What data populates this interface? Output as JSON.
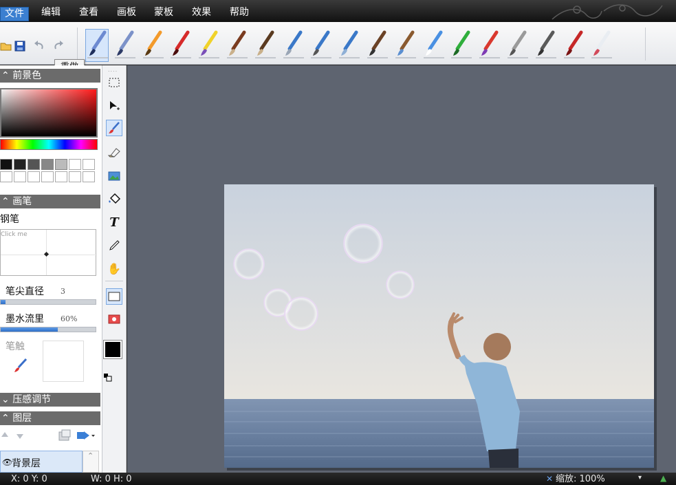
{
  "menu": {
    "items": [
      "文件",
      "编辑",
      "查看",
      "画板",
      "蒙板",
      "效果",
      "帮助"
    ],
    "active": 0
  },
  "toolbar": {
    "brushes": [
      {
        "icon": "pen-nib-icon"
      },
      {
        "icon": "calligraphy-pen-icon"
      },
      {
        "icon": "pencil-icon"
      },
      {
        "icon": "red-crayon-icon"
      },
      {
        "icon": "marker-icon"
      },
      {
        "icon": "oil-brush-icon"
      },
      {
        "icon": "flat-brush-icon"
      },
      {
        "icon": "airbrush-icon"
      },
      {
        "icon": "spray-dots-icon"
      },
      {
        "icon": "spray-lines-icon"
      },
      {
        "icon": "watercolor-brush-icon"
      },
      {
        "icon": "bucket-brush-icon"
      },
      {
        "icon": "sparkle-brush-icon"
      },
      {
        "icon": "grass-brush-icon"
      },
      {
        "icon": "flower-brush-icon"
      },
      {
        "icon": "texture-brush-icon"
      },
      {
        "icon": "dark-texture-brush-icon"
      },
      {
        "icon": "stamp-icon"
      },
      {
        "icon": "eraser-brush-icon"
      }
    ],
    "selected_brush": 0
  },
  "tooltip": {
    "text": "重做"
  },
  "left_panel": {
    "foreground_header": "前景色",
    "brush_header": "画笔",
    "brush_name": "钢笔",
    "preview_hint": "Click me",
    "diameter_label": "笔尖直径",
    "diameter_value": "3",
    "diameter_level": 0.05,
    "flow_label": "墨水流里",
    "flow_value": "60%",
    "flow_level": 0.6,
    "tip_label": "笔触",
    "pressure_header": "压感调节",
    "layers_header": "图层",
    "layer_name": "背景层"
  },
  "statusbar": {
    "coords": "X: 0 Y: 0",
    "size": "W: 0 H: 0",
    "zoom": "缩放: 100%"
  },
  "colors": {
    "menu_active": "#3b7fd0",
    "section_header": "#6b6b6b",
    "workarea": "#5e6470",
    "selection": "#d6e6fb"
  }
}
